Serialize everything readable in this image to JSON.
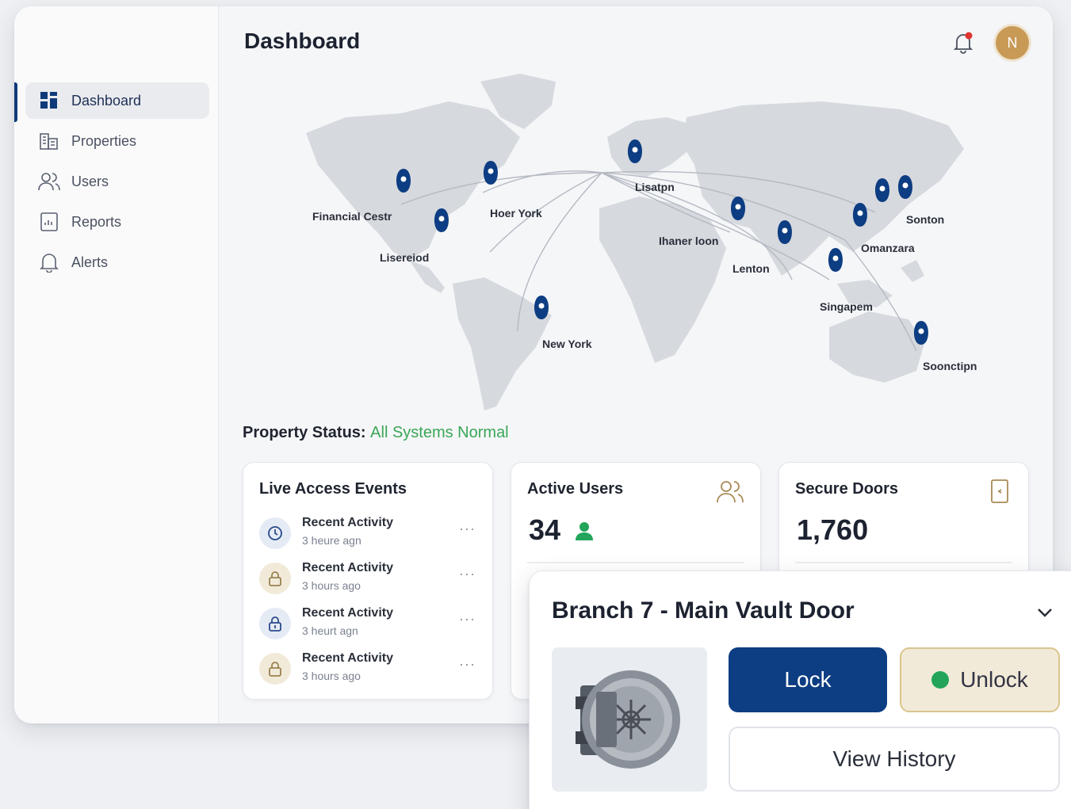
{
  "header": {
    "title": "Dashboard",
    "avatar_initial": "N"
  },
  "sidebar": {
    "items": [
      {
        "label": "Dashboard",
        "icon": "grid-icon",
        "active": true
      },
      {
        "label": "Properties",
        "icon": "building-icon"
      },
      {
        "label": "Users",
        "icon": "users-icon"
      },
      {
        "label": "Reports",
        "icon": "report-icon"
      },
      {
        "label": "Alerts",
        "icon": "bell-icon"
      }
    ]
  },
  "map": {
    "pins": [
      {
        "label": "Financial Cestr"
      },
      {
        "label": "Hoer York"
      },
      {
        "label": "Lisereiod"
      },
      {
        "label": "Lisatpn"
      },
      {
        "label": "Ihaner loon"
      },
      {
        "label": "Lenton"
      },
      {
        "label": "Singapem"
      },
      {
        "label": "Omanzara"
      },
      {
        "label": "Sonton"
      },
      {
        "label": "New York"
      },
      {
        "label": "Soonctipn"
      }
    ]
  },
  "status": {
    "label": "Property Status:",
    "value": "All Systems Normal"
  },
  "live_events": {
    "title": "Live Access Events",
    "events": [
      {
        "title": "Recent Activity",
        "time": "3 heure agn",
        "icon": "clock-icon"
      },
      {
        "title": "Recent Activity",
        "time": "3 hours ago",
        "icon": "lock-icon"
      },
      {
        "title": "Recent Activity",
        "time": "3 heurt agn",
        "icon": "unlock-icon"
      },
      {
        "title": "Recent Activity",
        "time": "3 hours ago",
        "icon": "lock-icon"
      }
    ],
    "menu_glyph": "···"
  },
  "active_users": {
    "title": "Active Users",
    "value": "34"
  },
  "secure_doors": {
    "title": "Secure Doors",
    "value": "1,760"
  },
  "vault": {
    "title": "Branch 7 - Main Vault Door",
    "lock_label": "Lock",
    "unlock_label": "Unlock",
    "history_label": "View History"
  },
  "colors": {
    "primary": "#0d3d82",
    "status_ok": "#3aa657",
    "avatar": "#c89a55",
    "unlock_dot": "#22a55a"
  }
}
